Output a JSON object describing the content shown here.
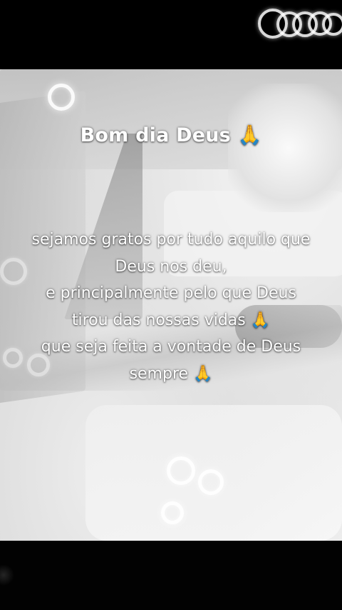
{
  "post": {
    "title": "Bom dia Deus 🙏",
    "message_lines": [
      "sejamos gratos por tudo aquilo que",
      "Deus nos deu,",
      "e principalmente pelo que Deus",
      "tirou das nossas vidas 🙏",
      "que seja feita a vontade de Deus",
      "sempre 🙏"
    ]
  },
  "colors": {
    "text": "#ffffff",
    "letterbox": "#000000",
    "photo_tone": "#d9d9d9"
  },
  "icons": {
    "decorative": "bokeh-rings"
  }
}
